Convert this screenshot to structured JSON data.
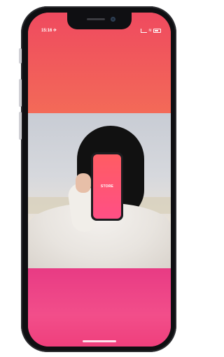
{
  "status_bar": {
    "time": "15:16 ✈",
    "right": ""
  },
  "in_photo_phone": {
    "label": "STORE"
  },
  "colors": {
    "top_gradient": "#ef4a5f",
    "bottom_gradient": "#e83b84"
  }
}
